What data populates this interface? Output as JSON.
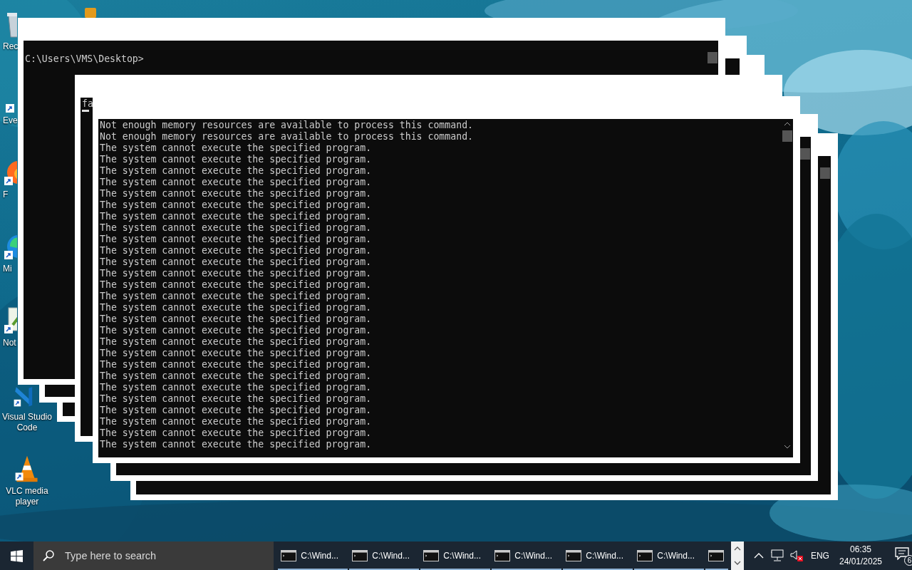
{
  "desktop_icons": [
    {
      "label": "Rec",
      "covered": true
    },
    {
      "label": "Eve",
      "covered": true
    },
    {
      "label": "F",
      "covered": true
    },
    {
      "label": "Mi",
      "covered": true
    },
    {
      "label": "Not",
      "covered": true
    },
    {
      "label": "Visual Studio Code",
      "covered": false
    },
    {
      "label": "VLC media player",
      "covered": false
    }
  ],
  "console_windows": [
    {
      "lines": [
        "C:\\Users\\VMS\\Desktop>"
      ],
      "cursor": false
    },
    {
      "lines": [
        "fa"
      ],
      "cursor": true
    },
    {
      "lines": [
        "Not enough memory resources are available to process this command.",
        "Not enough memory resources are available to process this command.",
        "The system cannot execute the specified program.",
        "The system cannot execute the specified program.",
        "The system cannot execute the specified program.",
        "The system cannot execute the specified program.",
        "The system cannot execute the specified program.",
        "The system cannot execute the specified program.",
        "The system cannot execute the specified program.",
        "The system cannot execute the specified program.",
        "The system cannot execute the specified program.",
        "The system cannot execute the specified program.",
        "The system cannot execute the specified program.",
        "The system cannot execute the specified program.",
        "The system cannot execute the specified program.",
        "The system cannot execute the specified program.",
        "The system cannot execute the specified program.",
        "The system cannot execute the specified program.",
        "The system cannot execute the specified program.",
        "The system cannot execute the specified program.",
        "The system cannot execute the specified program.",
        "The system cannot execute the specified program.",
        "The system cannot execute the specified program.",
        "The system cannot execute the specified program.",
        "The system cannot execute the specified program.",
        "The system cannot execute the specified program.",
        "The system cannot execute the specified program.",
        "The system cannot execute the specified program.",
        "The system cannot execute the specified program."
      ],
      "cursor": false
    }
  ],
  "taskbar": {
    "search": {
      "placeholder": "Type here to search"
    },
    "apps": [
      {
        "kind": "labeled",
        "label": "C:\\Wind..."
      },
      {
        "kind": "labeled",
        "label": "C:\\Wind..."
      },
      {
        "kind": "labeled",
        "label": "C:\\Wind..."
      },
      {
        "kind": "labeled",
        "label": "C:\\Wind..."
      },
      {
        "kind": "labeled",
        "label": "C:\\Wind..."
      },
      {
        "kind": "labeled",
        "label": "C:\\Wind..."
      },
      {
        "kind": "icon_only"
      }
    ],
    "language": "ENG",
    "time": "06:35",
    "date": "24/01/2025",
    "notifications": "6"
  }
}
